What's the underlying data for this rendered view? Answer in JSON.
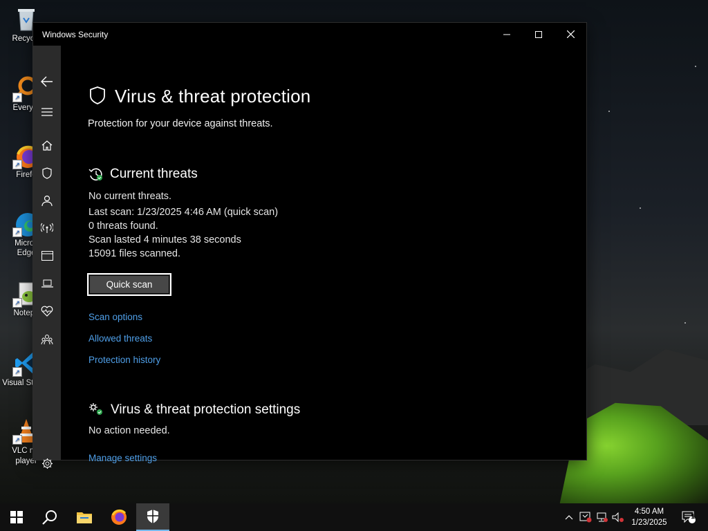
{
  "window": {
    "title": "Windows Security"
  },
  "page": {
    "title": "Virus & threat protection",
    "subtitle": "Protection for your device against threats."
  },
  "current_threats": {
    "heading": "Current threats",
    "lines": [
      "No current threats.",
      "Last scan: 1/23/2025 4:46 AM (quick scan)",
      "0 threats found.",
      "Scan lasted 4 minutes 38 seconds",
      "15091 files scanned."
    ],
    "button": "Quick scan",
    "links": [
      "Scan options",
      "Allowed threats",
      "Protection history"
    ]
  },
  "settings": {
    "heading": "Virus & threat protection settings",
    "status": "No action needed.",
    "link": "Manage settings"
  },
  "desktop_icons": [
    "Recycle",
    "Everyth",
    "Firefo",
    "Micros Edge",
    "Notepa",
    "Visual St Cod",
    "VLC me player"
  ],
  "taskbar": {
    "time": "4:50 AM",
    "date": "1/23/2025",
    "notification_count": "1"
  },
  "colors": {
    "link": "#4f9fe8",
    "sidebar": "#2b2b2b",
    "window_bg": "#000000",
    "taskbar": "#101010"
  }
}
